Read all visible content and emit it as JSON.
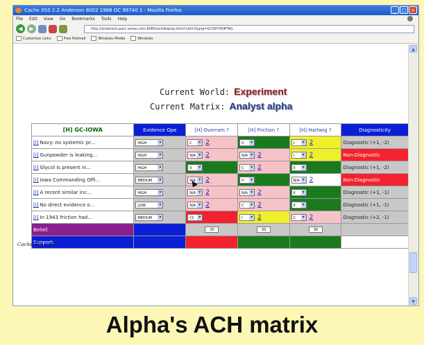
{
  "window": {
    "title": "Cache XSS 2.2 Anderson 8002 1988 GC 99740 1 - Mozilla Firefox",
    "controls": [
      "_",
      "□",
      "×"
    ]
  },
  "menu": [
    "File",
    "Edit",
    "View",
    "Go",
    "Bookmarks",
    "Tools",
    "Help"
  ],
  "address": "http://anderson.parc.xerox.com:8080/achdisplay.html?uid=2&plg=GC99740#TAG",
  "bookmarks": [
    "Customize Links",
    "Free Hotmail",
    "Windows Media",
    "Windows"
  ],
  "world": {
    "label": "Current World:",
    "value": "Experiment",
    "value_color": "#8e1b1b"
  },
  "matrix_label": {
    "label": "Current Matrix:",
    "value": "Analyst alpha",
    "value_color": "#1e3a8a"
  },
  "table": {
    "header": {
      "evidence": "[H] GC-IOWA",
      "ope": "Evidence Ope",
      "h1": "[H] Overram ?",
      "h2": "[H] Friction ?",
      "h3": "[H] Hartwig ?",
      "diag": "Diagnosticity"
    },
    "rows": [
      {
        "link": "[I]",
        "text": "Navy: no systemic pr...",
        "ope": "HIGH",
        "h1": {
          "val": "C",
          "q": "2",
          "color": "pink"
        },
        "h2": {
          "val": "II",
          "q": "",
          "color": "green"
        },
        "h3": {
          "val": "I",
          "q": "2",
          "color": "yellow"
        },
        "diag": "Diagnostic (+1, -2)",
        "diag_color": "normal"
      },
      {
        "link": "[I]",
        "text": "Gunpowder is leaking...",
        "ope": "HIGH",
        "h1": {
          "val": "N/A",
          "q": "2",
          "color": "pink"
        },
        "h2": {
          "val": "N/A",
          "q": "2",
          "color": "pink"
        },
        "h3": {
          "val": "I",
          "q": "2",
          "color": "yellow"
        },
        "diag": "Non-Diagnostic",
        "diag_color": "red"
      },
      {
        "link": "[I]",
        "text": "Glycol is present in...",
        "ope": "HIGH",
        "h1": {
          "val": "II",
          "q": "",
          "color": "green"
        },
        "h2": {
          "val": "C",
          "q": "2",
          "color": "pink"
        },
        "h3": {
          "val": "II",
          "q": "",
          "color": "green"
        },
        "diag": "Diagnostic (+1, -2)",
        "diag_color": "normal"
      },
      {
        "link": "[I]",
        "text": "Iowa Commanding Offi...",
        "ope": "MEDIUM",
        "h1": {
          "val": "N/A",
          "q": "2",
          "color": "pink"
        },
        "h2": {
          "val": "II",
          "q": "",
          "color": "green"
        },
        "h3": {
          "val": "N/A",
          "q": "2",
          "color": "white"
        },
        "diag": "Non-Diagnostic",
        "diag_color": "red"
      },
      {
        "link": "[I]",
        "text": "A recent similar inc...",
        "ope": "HIGH",
        "h1": {
          "val": "N/A",
          "q": "2",
          "color": "pink"
        },
        "h2": {
          "val": "N/A",
          "q": "2",
          "color": "pink"
        },
        "h3": {
          "val": "II",
          "q": "",
          "color": "green"
        },
        "diag": "Diagnostic (+1, -1)",
        "diag_color": "normal"
      },
      {
        "link": "[I]",
        "text": "No direct evidence o...",
        "ope": "LOW",
        "h1": {
          "val": "N/A",
          "q": "2",
          "color": "pink"
        },
        "h2": {
          "val": "C",
          "q": "2",
          "color": "pink"
        },
        "h3": {
          "val": "II",
          "q": "",
          "color": "green"
        },
        "diag": "Diagnostic (+1, -1)",
        "diag_color": "normal"
      },
      {
        "link": "[I]",
        "text": "In 1943 friction had...",
        "ope": "MEDIUM",
        "h1": {
          "val": "CC",
          "q": "",
          "color": "red"
        },
        "h2": {
          "val": "I",
          "q": "2",
          "color": "yellow"
        },
        "h3": {
          "val": "C",
          "q": "2",
          "color": "pink"
        },
        "diag": "Diagnostic (+2, -1)",
        "diag_color": "normal"
      }
    ],
    "belief": {
      "label": "Belief:",
      "h1": "20",
      "h2": "50",
      "h3": "30"
    },
    "support": {
      "label": "Support:",
      "h1_color": "red",
      "h2_color": "green",
      "h3_color": "green"
    }
  },
  "footer": "Cache Xth v 2.2",
  "caption": "Alpha's ACH matrix"
}
